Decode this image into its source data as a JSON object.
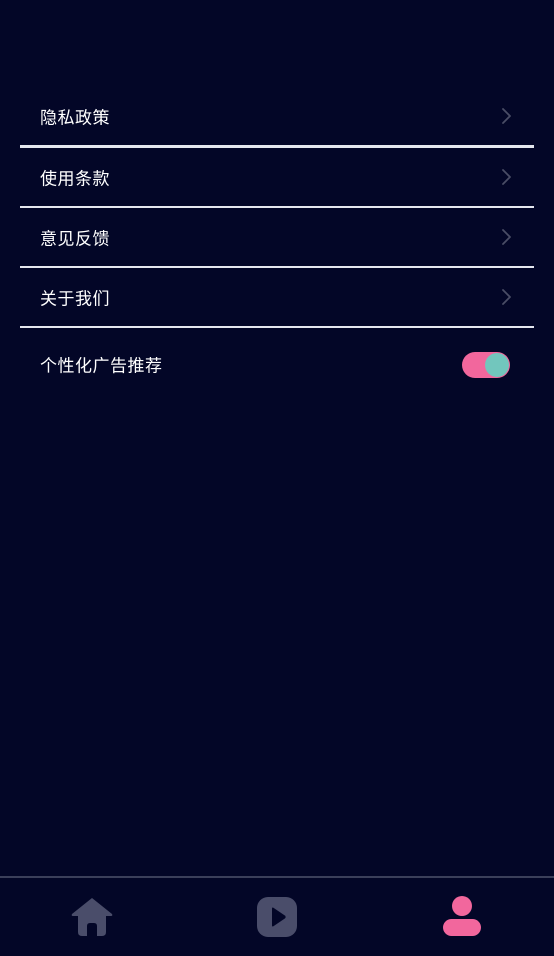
{
  "settings": {
    "items": [
      {
        "label": "隐私政策",
        "icon": "chevron-right-icon"
      },
      {
        "label": "使用条款",
        "icon": "chevron-right-icon"
      },
      {
        "label": "意见反馈",
        "icon": "chevron-right-icon"
      },
      {
        "label": "关于我们",
        "icon": "chevron-right-icon"
      }
    ],
    "ad_toggle": {
      "label": "个性化广告推荐",
      "enabled": true
    }
  },
  "bottom_nav": {
    "items": [
      {
        "icon": "home-icon",
        "active": false
      },
      {
        "icon": "play-icon",
        "active": false
      },
      {
        "icon": "profile-icon",
        "active": true
      }
    ]
  },
  "colors": {
    "background": "#030627",
    "accent": "#f2679d",
    "toggle_knob": "#72c6bd",
    "inactive_icon": "#4a4d6a"
  }
}
